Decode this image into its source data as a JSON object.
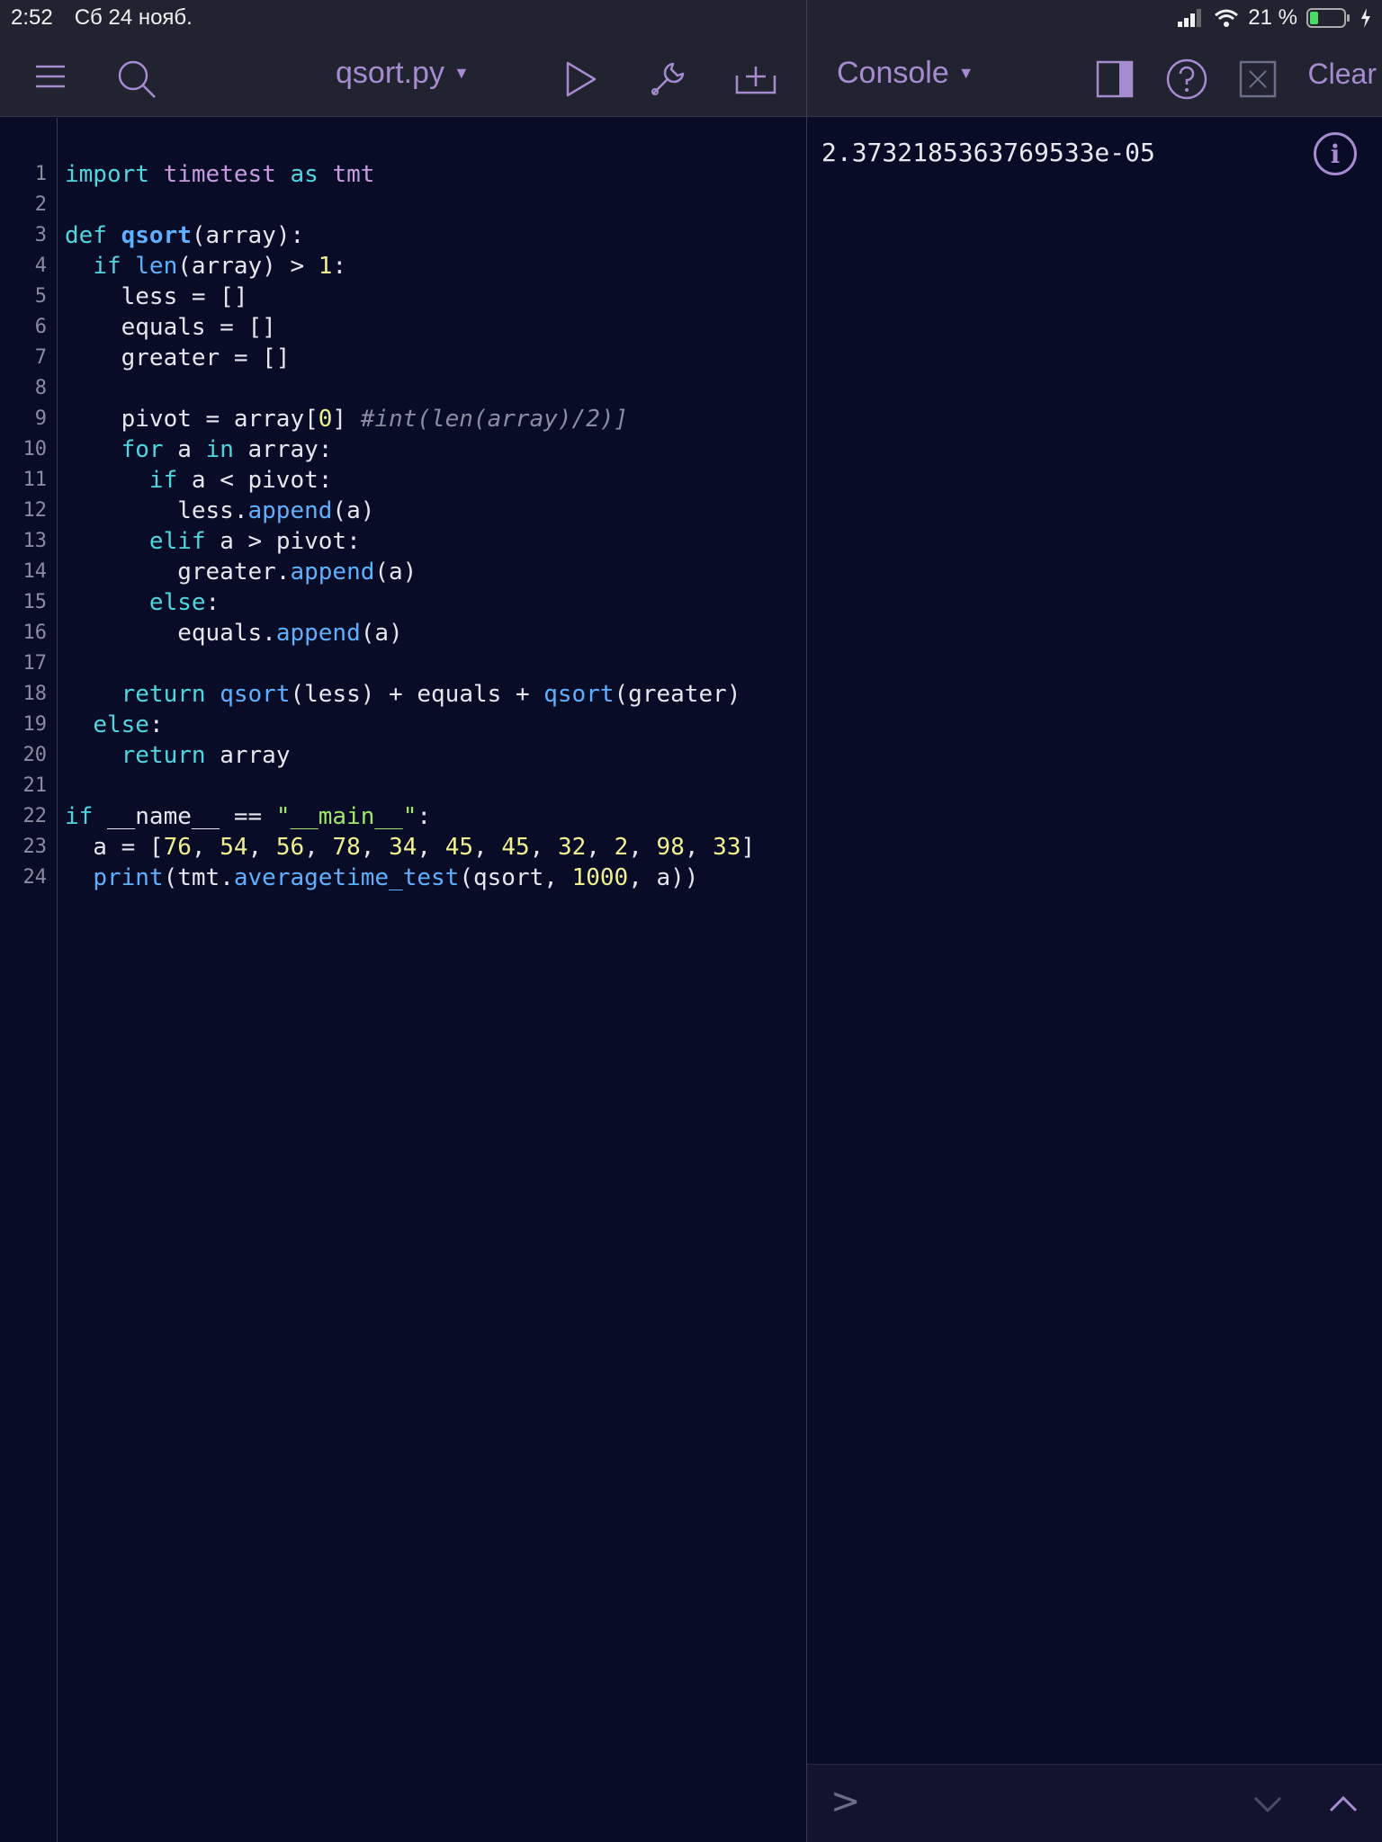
{
  "status": {
    "time": "2:52",
    "date": "Сб 24 нояб.",
    "battery": "21 %"
  },
  "editor": {
    "file_title": "qsort.py",
    "lines": [
      [
        [
          "kw",
          "import"
        ],
        [
          "t",
          " "
        ],
        [
          "mod",
          "timetest"
        ],
        [
          "t",
          " "
        ],
        [
          "kw",
          "as"
        ],
        [
          "t",
          " "
        ],
        [
          "mod",
          "tmt"
        ]
      ],
      [],
      [
        [
          "kw",
          "def"
        ],
        [
          "t",
          " "
        ],
        [
          "fnb",
          "qsort"
        ],
        [
          "t",
          "(array):"
        ]
      ],
      [
        [
          "t",
          "  "
        ],
        [
          "kw",
          "if"
        ],
        [
          "t",
          " "
        ],
        [
          "fn",
          "len"
        ],
        [
          "t",
          "(array) > "
        ],
        [
          "num",
          "1"
        ],
        [
          "t",
          ":"
        ]
      ],
      [
        [
          "t",
          "    less = []"
        ]
      ],
      [
        [
          "t",
          "    equals = []"
        ]
      ],
      [
        [
          "t",
          "    greater = []"
        ]
      ],
      [],
      [
        [
          "t",
          "    pivot = array["
        ],
        [
          "num",
          "0"
        ],
        [
          "t",
          "] "
        ],
        [
          "cmt",
          "#int(len(array)/2)]"
        ]
      ],
      [
        [
          "t",
          "    "
        ],
        [
          "kw",
          "for"
        ],
        [
          "t",
          " a "
        ],
        [
          "kw",
          "in"
        ],
        [
          "t",
          " array:"
        ]
      ],
      [
        [
          "t",
          "      "
        ],
        [
          "kw",
          "if"
        ],
        [
          "t",
          " a < pivot:"
        ]
      ],
      [
        [
          "t",
          "        less."
        ],
        [
          "fn",
          "append"
        ],
        [
          "t",
          "(a)"
        ]
      ],
      [
        [
          "t",
          "      "
        ],
        [
          "kw",
          "elif"
        ],
        [
          "t",
          " a > pivot:"
        ]
      ],
      [
        [
          "t",
          "        greater."
        ],
        [
          "fn",
          "append"
        ],
        [
          "t",
          "(a)"
        ]
      ],
      [
        [
          "t",
          "      "
        ],
        [
          "kw",
          "else"
        ],
        [
          "t",
          ":"
        ]
      ],
      [
        [
          "t",
          "        equals."
        ],
        [
          "fn",
          "append"
        ],
        [
          "t",
          "(a)"
        ]
      ],
      [],
      [
        [
          "t",
          "    "
        ],
        [
          "kw",
          "return"
        ],
        [
          "t",
          " "
        ],
        [
          "fn",
          "qsort"
        ],
        [
          "t",
          "(less) + equals + "
        ],
        [
          "fn",
          "qsort"
        ],
        [
          "t",
          "(greater)"
        ]
      ],
      [
        [
          "t",
          "  "
        ],
        [
          "kw",
          "else"
        ],
        [
          "t",
          ":"
        ]
      ],
      [
        [
          "t",
          "    "
        ],
        [
          "kw",
          "return"
        ],
        [
          "t",
          " array"
        ]
      ],
      [],
      [
        [
          "kw",
          "if"
        ],
        [
          "t",
          " __name__ == "
        ],
        [
          "str",
          "\"__main__\""
        ],
        [
          "t",
          ":"
        ]
      ],
      [
        [
          "t",
          "  a = ["
        ],
        [
          "num",
          "76"
        ],
        [
          "t",
          ", "
        ],
        [
          "num",
          "54"
        ],
        [
          "t",
          ", "
        ],
        [
          "num",
          "56"
        ],
        [
          "t",
          ", "
        ],
        [
          "num",
          "78"
        ],
        [
          "t",
          ", "
        ],
        [
          "num",
          "34"
        ],
        [
          "t",
          ", "
        ],
        [
          "num",
          "45"
        ],
        [
          "t",
          ", "
        ],
        [
          "num",
          "45"
        ],
        [
          "t",
          ", "
        ],
        [
          "num",
          "32"
        ],
        [
          "t",
          ", "
        ],
        [
          "num",
          "2"
        ],
        [
          "t",
          ", "
        ],
        [
          "num",
          "98"
        ],
        [
          "t",
          ", "
        ],
        [
          "num",
          "33"
        ],
        [
          "t",
          "]"
        ]
      ],
      [
        [
          "t",
          "  "
        ],
        [
          "fn",
          "print"
        ],
        [
          "t",
          "(tmt."
        ],
        [
          "fn",
          "averagetime_test"
        ],
        [
          "t",
          "(qsort, "
        ],
        [
          "num",
          "1000"
        ],
        [
          "t",
          ", a))"
        ]
      ]
    ]
  },
  "console": {
    "title": "Console",
    "clear_label": "Clear",
    "output": "2.3732185363769533e-05",
    "info_label": "i",
    "prompt": ">"
  },
  "icons": {
    "menu": "menu-icon",
    "search": "search-icon",
    "run": "play-icon",
    "tools": "wrench-icon",
    "share": "add-to-tray-icon",
    "layout": "split-view-icon",
    "help": "question-icon",
    "close": "close-icon",
    "scroll_down": "chevron-down-icon",
    "scroll_up": "chevron-up-icon"
  }
}
